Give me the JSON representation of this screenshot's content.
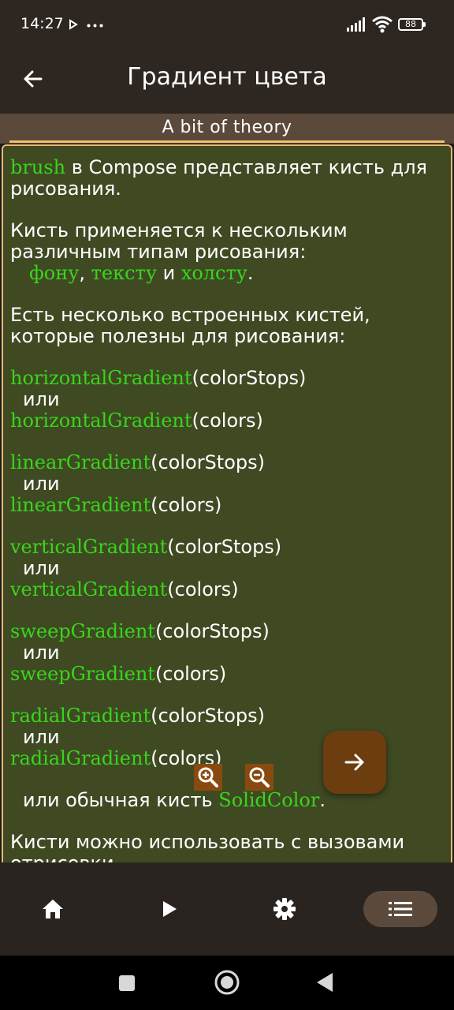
{
  "status_bar": {
    "time": "14:27",
    "battery": "88"
  },
  "top_bar": {
    "title": "Градиент цвета"
  },
  "section": {
    "title": "A bit of theory"
  },
  "content": {
    "p1_kw": "brush",
    "p1_text": " в Compose представляет кисть для рисования.",
    "p2_text": "Кисть применяется к нескольким различным типам рисования:",
    "p2_kw1": "фону",
    "p2_sep1": ", ",
    "p2_kw2": "тексту",
    "p2_sep2": " и ",
    "p2_kw3": "холсту",
    "p2_end": ".",
    "p3_text": "Есть несколько встроенных кистей, которые полезны для рисования:",
    "or": "или",
    "gradients": {
      "horizontal": "horizontalGradient",
      "linear": "linearGradient",
      "vertical": "verticalGradient",
      "sweep": "sweepGradient",
      "radial": "radialGradient"
    },
    "arg_color_stops": "(colorStops)",
    "arg_colors": "(colors)",
    "solid_prefix": "или обычная кисть ",
    "solid_kw": "SolidColor",
    "solid_end": ".",
    "p_last": "Кисти можно использовать с вызовами отрисовки"
  },
  "icons": {
    "back": "arrow-left-icon",
    "zoom_in": "zoom-in-icon",
    "zoom_out": "zoom-out-icon",
    "next": "arrow-right-icon",
    "nav_home": "home-icon",
    "nav_play": "play-icon",
    "nav_settings": "gear-icon",
    "nav_list": "list-icon"
  },
  "colors": {
    "keyword": "#39d51c",
    "card_bg": "#3f4a23",
    "card_border": "#e8b973",
    "accent": "#8a4a0f",
    "fab": "#6b3d0f"
  }
}
